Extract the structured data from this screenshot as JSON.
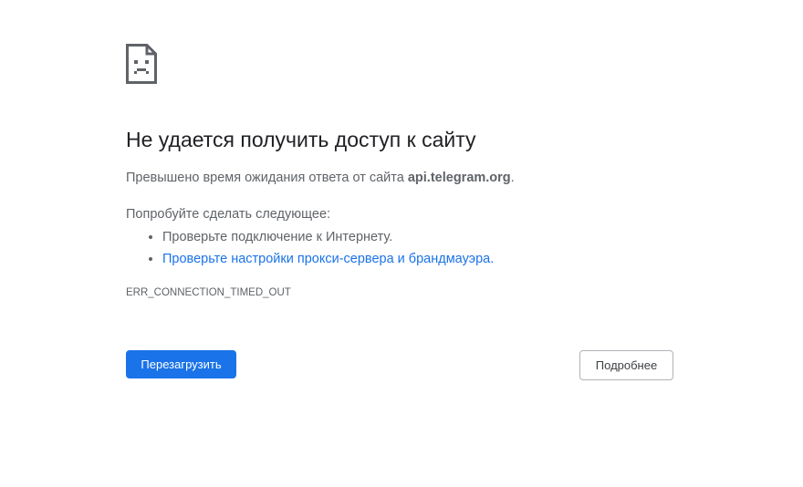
{
  "error_page": {
    "icon": "sad-page-icon",
    "title": "Не удается получить доступ к сайту",
    "summary_prefix": "Превышено время ожидания ответа от сайта ",
    "summary_host": "api.telegram.org",
    "summary_suffix": ".",
    "suggestions_heading": "Попробуйте сделать следующее:",
    "suggestions": [
      {
        "text": "Проверьте подключение к Интернету.",
        "is_link": false
      },
      {
        "text": "Проверьте настройки прокси-сервера и брандмауэра.",
        "is_link": true
      }
    ],
    "error_code": "ERR_CONNECTION_TIMED_OUT"
  },
  "buttons": {
    "reload_label": "Перезагрузить",
    "details_label": "Подробнее"
  },
  "colors": {
    "primary": "#1a73e8",
    "text": "#202124",
    "secondary_text": "#5f6368"
  }
}
